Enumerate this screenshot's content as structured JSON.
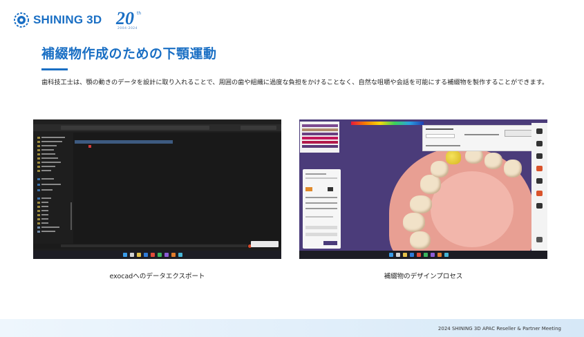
{
  "brand": {
    "logo_text": "SHINING 3D",
    "anniversary_number": "20",
    "anniversary_suffix": "th",
    "anniversary_years": "2004-2024"
  },
  "slide": {
    "title": "補綴物作成のための下顎運動",
    "description": "歯科技工士は、顎の動きのデータを設計に取り入れることで、周囲の歯や組織に過度な負担をかけることなく、自然な咀嚼や会話を可能にする補綴物を製作することができます。"
  },
  "screens": [
    {
      "caption": "exocadへのデータエクスポート",
      "window": "explorer"
    },
    {
      "caption": "補綴物のデザインプロセス",
      "window": "exocad"
    }
  ],
  "footer": {
    "text": "2024 SHINING 3D APAC Reseller & Partner Meeting"
  },
  "colors": {
    "brand_blue": "#1a6fc4",
    "footer_band": "#dcebf8"
  }
}
